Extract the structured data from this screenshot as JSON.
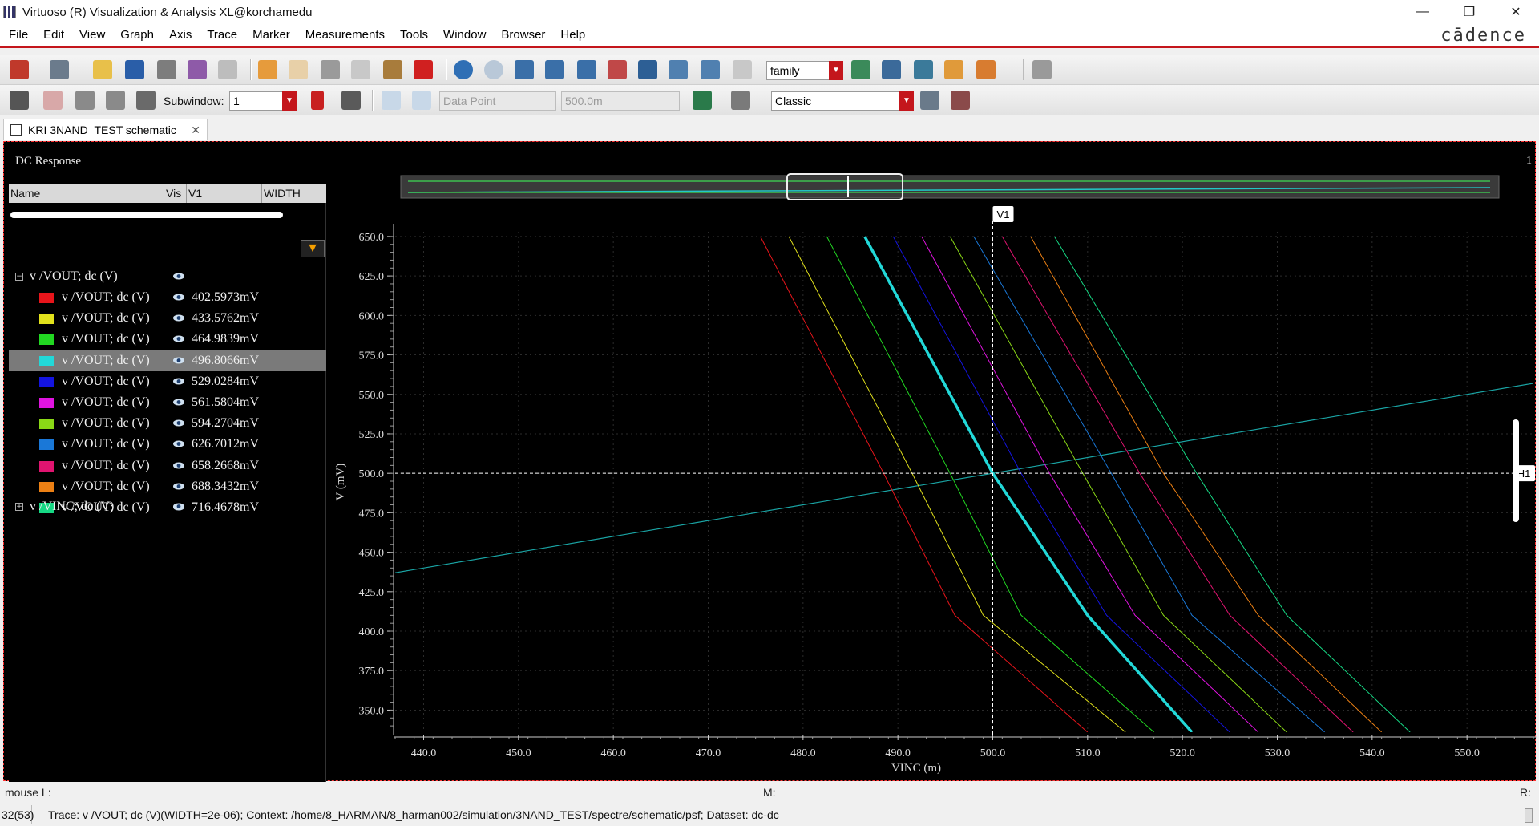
{
  "window": {
    "title": "Virtuoso (R) Visualization & Analysis XL@korchamedu",
    "controls": [
      "—",
      "❐",
      "✕"
    ]
  },
  "menu": [
    "File",
    "Edit",
    "View",
    "Graph",
    "Axis",
    "Trace",
    "Marker",
    "Measurements",
    "Tools",
    "Window",
    "Browser",
    "Help"
  ],
  "brand": "cādence",
  "toolbar": {
    "family_combo": "family",
    "subwindow_label": "Subwindow:",
    "subwindow_value": "1",
    "data_point": "Data Point",
    "data_value": "500.0m",
    "style_combo": "Classic"
  },
  "tab": {
    "label": "KRI 3NAND_TEST schematic",
    "close": "✕"
  },
  "subwindow": {
    "title": "DC Response",
    "number": "1"
  },
  "legend": {
    "headers": [
      "Name",
      "Vis",
      "V1",
      "WIDTH"
    ],
    "group_vout": "v /VOUT; dc (V)",
    "group_vinc": "v /VINC; dc (V)",
    "traces": [
      {
        "name": "v /VOUT; dc (V)",
        "color": "#e8151b",
        "value": "402.5973mV"
      },
      {
        "name": "v /VOUT; dc (V)",
        "color": "#e2e21c",
        "value": "433.5762mV"
      },
      {
        "name": "v /VOUT; dc (V)",
        "color": "#22d822",
        "value": "464.9839mV"
      },
      {
        "name": "v /VOUT; dc (V)",
        "color": "#22d8d8",
        "value": "496.8066mV"
      },
      {
        "name": "v /VOUT; dc (V)",
        "color": "#1414e0",
        "value": "529.0284mV"
      },
      {
        "name": "v /VOUT; dc (V)",
        "color": "#e014e0",
        "value": "561.5804mV"
      },
      {
        "name": "v /VOUT; dc (V)",
        "color": "#8ad816",
        "value": "594.2704mV"
      },
      {
        "name": "v /VOUT; dc (V)",
        "color": "#1a78d8",
        "value": "626.7012mV"
      },
      {
        "name": "v /VOUT; dc (V)",
        "color": "#e01470",
        "value": "658.2668mV"
      },
      {
        "name": "v /VOUT; dc (V)",
        "color": "#ec8014",
        "value": "688.3432mV"
      },
      {
        "name": "v /VOUT; dc (V)",
        "color": "#16d884",
        "value": "716.4678mV"
      }
    ],
    "selected_index": 3
  },
  "chart_data": {
    "type": "line",
    "xlabel": "VINC (m)",
    "ylabel": "V (mV)",
    "xlim": [
      437,
      557
    ],
    "ylim": [
      336,
      653
    ],
    "xticks": [
      "440.0",
      "450.0",
      "460.0",
      "470.0",
      "480.0",
      "490.0",
      "500.0",
      "510.0",
      "520.0",
      "530.0",
      "540.0",
      "550.0"
    ],
    "yticks": [
      "350.0",
      "375.0",
      "400.0",
      "425.0",
      "450.0",
      "475.0",
      "500.0",
      "525.0",
      "550.0",
      "575.0",
      "600.0",
      "625.0",
      "650.0"
    ],
    "grid": true,
    "markers": {
      "vertical": "V1",
      "vertical_x": 500,
      "horizontal": "H1",
      "horizontal_y": 500
    },
    "vinc_series": {
      "name": "v /VINC; dc (V)",
      "color": "#1aa5a5",
      "points": [
        [
          437,
          437
        ],
        [
          557,
          557
        ]
      ]
    },
    "vout_series": [
      {
        "color": "#e8151b",
        "x_at_650": 475.5,
        "x_at_500": 488.5,
        "x_at_410": 496.0,
        "x_at_336": 510.0
      },
      {
        "color": "#e2e21c",
        "x_at_650": 478.5,
        "x_at_500": 491.5,
        "x_at_410": 499.0,
        "x_at_336": 514.0
      },
      {
        "color": "#22d822",
        "x_at_650": 482.5,
        "x_at_500": 495.5,
        "x_at_410": 503.0,
        "x_at_336": 517.0
      },
      {
        "color": "#22d8d8",
        "x_at_650": 486.5,
        "x_at_500": 500.0,
        "x_at_410": 510.0,
        "x_at_336": 521.0,
        "bold": true
      },
      {
        "color": "#1414e0",
        "x_at_650": 489.5,
        "x_at_500": 503.0,
        "x_at_410": 512.0,
        "x_at_336": 525.0
      },
      {
        "color": "#e014e0",
        "x_at_650": 492.5,
        "x_at_500": 506.0,
        "x_at_410": 515.0,
        "x_at_336": 528.0
      },
      {
        "color": "#8ad816",
        "x_at_650": 495.5,
        "x_at_500": 509.5,
        "x_at_410": 518.0,
        "x_at_336": 531.0
      },
      {
        "color": "#1a78d8",
        "x_at_650": 498.0,
        "x_at_500": 512.5,
        "x_at_410": 521.0,
        "x_at_336": 535.0
      },
      {
        "color": "#e01470",
        "x_at_650": 501.0,
        "x_at_500": 515.5,
        "x_at_410": 525.0,
        "x_at_336": 538.0
      },
      {
        "color": "#ec8014",
        "x_at_650": 504.0,
        "x_at_500": 518.0,
        "x_at_410": 528.0,
        "x_at_336": 541.0
      },
      {
        "color": "#16d884",
        "x_at_650": 506.5,
        "x_at_500": 521.5,
        "x_at_410": 531.0,
        "x_at_336": 544.0
      }
    ]
  },
  "status": {
    "mouse_left": "mouse L:",
    "mouse_mid": "M:",
    "mouse_right": "R:",
    "count": "32(53)",
    "trace_info": "Trace: v /VOUT; dc (V)(WIDTH=2e-06); Context: /home/8_HARMAN/8_harman002/simulation/3NAND_TEST/spectre/schematic/psf; Dataset: dc-dc"
  }
}
